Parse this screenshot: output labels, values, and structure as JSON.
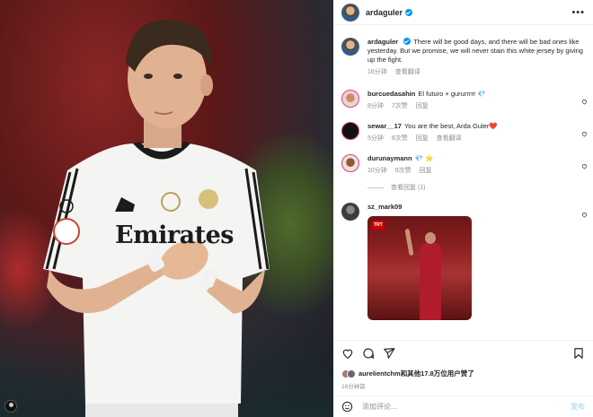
{
  "photo": {
    "colors": {
      "jersey": "#f4f4f2",
      "accent": "#b8a15a",
      "stadium_red": "#8a2626"
    },
    "jersey_text": "Emirates"
  },
  "post_header": {
    "username": "ardaguler",
    "verified": true,
    "more_icon": "more-horizontal-icon"
  },
  "caption": {
    "username": "ardaguler",
    "text": "There will be good days, and there will be bad ones like yesterday. But we promise, we will never stain this white jersey by giving up the fight.",
    "time": "16分钟",
    "translate": "查看翻译"
  },
  "comments": [
    {
      "username": "burcuedasahin",
      "text": "El futuro + gururrrrr 💎",
      "time": "8分钟",
      "likes": "7次赞",
      "reply": "回复",
      "translate": ""
    },
    {
      "username": "sewar__17",
      "text": "You are the best, Arda Guler❤️",
      "time": "5分钟",
      "likes": "8次赞",
      "reply": "回复",
      "translate": "查看翻译"
    },
    {
      "username": "durunaymann",
      "text": "💎 ⭐",
      "time": "10分钟",
      "likes": "9次赞",
      "reply": "回复",
      "translate": ""
    }
  ],
  "view_replies": "查看回复 (1)",
  "image_comment": {
    "username": "sz_mark09",
    "image_badge": "TRT"
  },
  "actions": {
    "icons": [
      "heart-icon",
      "comment-icon",
      "share-icon",
      "bookmark-icon"
    ]
  },
  "likes": {
    "user": "aurelientchm",
    "text": "和其他17.8万位用户赞了",
    "time": "16分钟前"
  },
  "add_comment": {
    "placeholder": "添加评论...",
    "post_label": "发布"
  },
  "colors": {
    "link_blue": "#0095f6",
    "muted": "#8e8e8e",
    "text": "#262626"
  }
}
